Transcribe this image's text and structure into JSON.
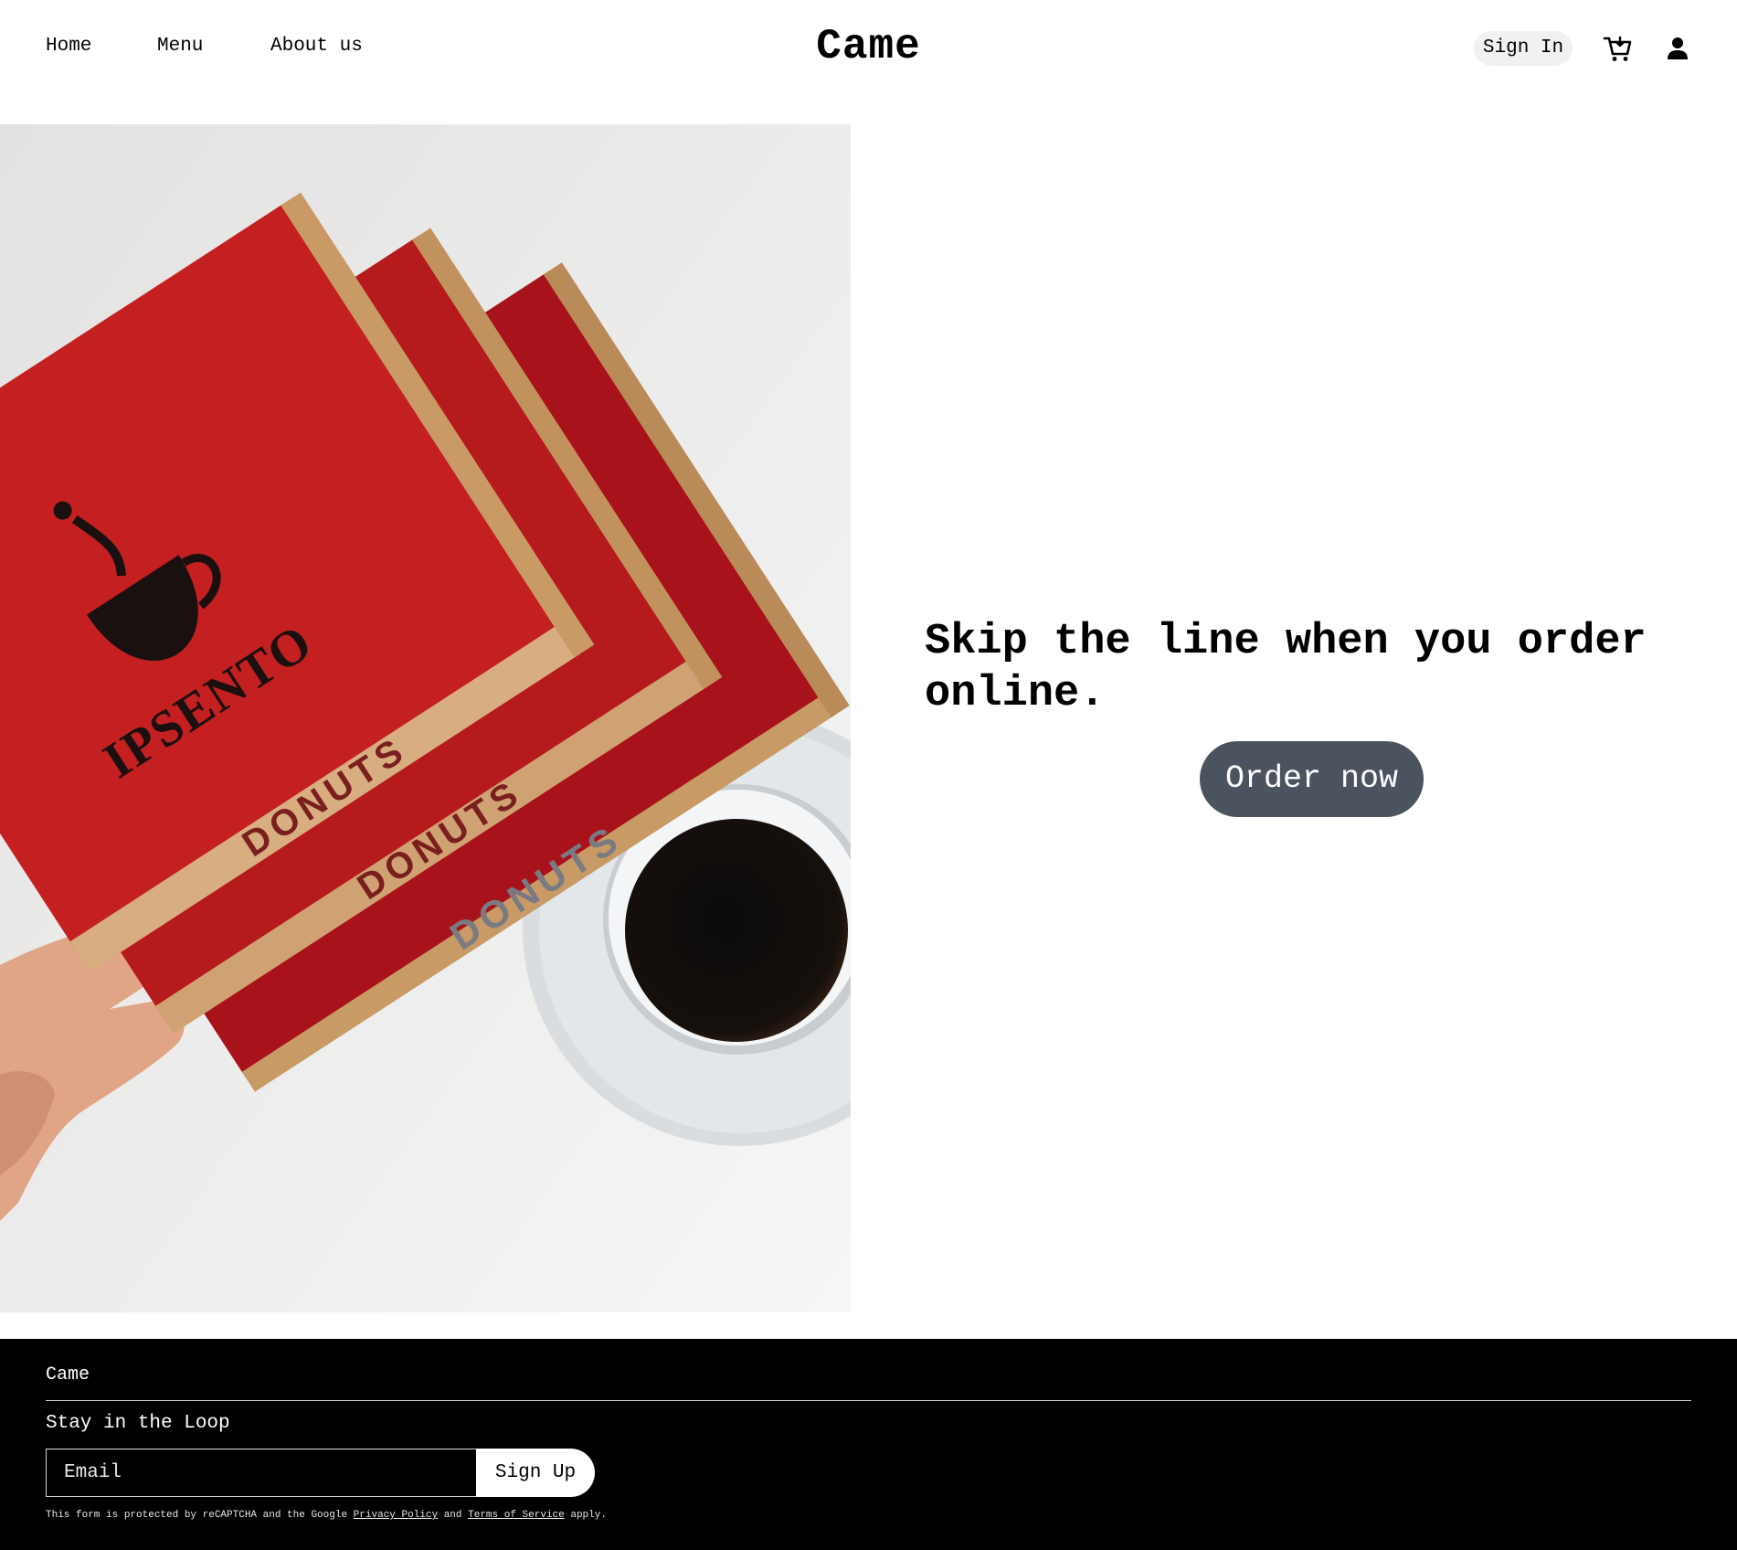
{
  "header": {
    "nav": [
      {
        "label": "Home"
      },
      {
        "label": "Menu"
      },
      {
        "label": "About us"
      }
    ],
    "brand": "Came",
    "sign_in_label": "Sign In",
    "cart_icon": "cart-icon",
    "account_icon": "person-icon"
  },
  "hero": {
    "image_text": {
      "logo_word": "IPSENTO",
      "box_label": "DONUTS"
    },
    "headline": "Skip the line when you order online.",
    "order_button": "Order now"
  },
  "footer": {
    "brand": "Came",
    "newsletter_title": "Stay in the Loop",
    "email_placeholder": "Email",
    "signup_label": "Sign Up",
    "legal": {
      "prefix": "This form is protected by reCAPTCHA and the Google",
      "privacy_link": "Privacy Policy",
      "and": "and",
      "terms_link": "Terms of Service",
      "suffix": "apply."
    }
  },
  "colors": {
    "order_button_bg": "#4b535e",
    "signin_bg": "#f1f1f1",
    "footer_bg": "#000000",
    "box_red": "#b31818"
  }
}
